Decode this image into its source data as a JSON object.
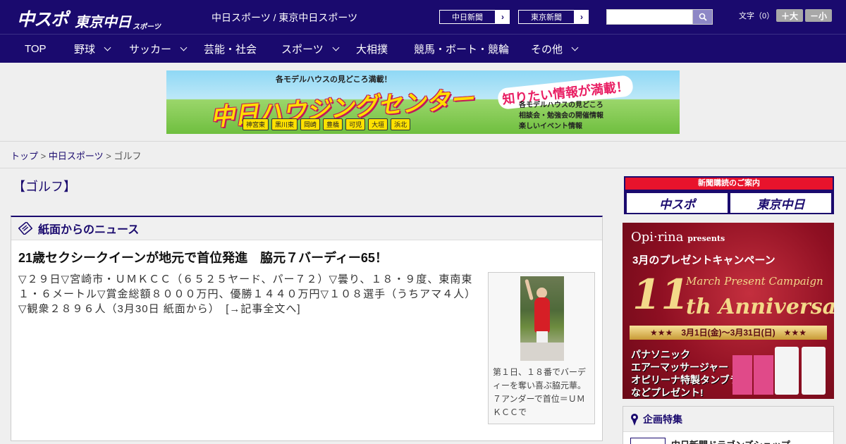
{
  "header": {
    "logo_main": "中スポ",
    "logo_sub": "東京中日",
    "logo_sub_small": "スポーツ",
    "site_title": "中日スポーツ / 東京中日スポーツ",
    "btn_chunichi": "中日新聞",
    "btn_tokyo": "東京新聞",
    "search_placeholder": "",
    "font_label": "文字（0）",
    "font_larger": "＋大",
    "font_smaller": "－小"
  },
  "nav": [
    {
      "label": "TOP",
      "dropdown": false
    },
    {
      "label": "野球",
      "dropdown": true
    },
    {
      "label": "サッカー",
      "dropdown": true
    },
    {
      "label": "芸能・社会",
      "dropdown": false
    },
    {
      "label": "スポーツ",
      "dropdown": true
    },
    {
      "label": "大相撲",
      "dropdown": false
    },
    {
      "label": "競馬・ボート・競輪",
      "dropdown": false
    },
    {
      "label": "その他",
      "dropdown": true
    }
  ],
  "ad": {
    "tagline": "各モデルハウスの見どころ満載！",
    "title": "中日ハウジングセンター",
    "side": "知りたい情報が満載！",
    "bullets": [
      "各モデルハウスの見どころ",
      "相談会・勉強会の開催情報",
      "楽しいイベント情報"
    ],
    "cities": [
      "神宮東",
      "黒川東",
      "岡崎",
      "豊橋",
      "可児",
      "大垣",
      "浜北"
    ]
  },
  "breadcrumb": {
    "top": "トップ",
    "section": "中日スポーツ",
    "current": "ゴルフ",
    "sep": ">"
  },
  "page_title": "【ゴルフ】",
  "news": {
    "section_title": "紙面からのニュース",
    "headline": "21歳セクシークイーンが地元で首位発進　脇元７バーディー65！",
    "body": "▽２９日▽宮崎市・ＵＭＫＣＣ（６５２５ヤード、パー７２）▽曇り、１８・９度、東南東１・６メートル▽賞金総額８０００万円、優勝１４４０万円▽１０８選手（うちアマ４人）▽観衆２８９６人（3月30日 紙面から）　[→記事全文へ]",
    "caption": "第１日、１８番でバーディーを奪い喜ぶ脇元華。７アンダーで首位＝ＵＭＫＣＣで"
  },
  "sidebar": {
    "subscribe_title": "新聞購読のご案内",
    "subscribe_btn1": "中スポ",
    "subscribe_btn2": "東京中日",
    "promo": {
      "brand": "Opi·rina",
      "presents": "presents",
      "campaign": "3月のプレゼントキャンペーン",
      "number": "11",
      "subtitle": "March Present Campaign",
      "anniversary": "th Anniversary",
      "dates": "★★★　3月1日(金)〜3月31日(日)　★★★",
      "gift_line1": "パナソニック",
      "gift_line2": "エアーマッサージャー",
      "gift_line3": "オピリーナ特製タンブラー",
      "gift_line4": "などプレゼント!"
    },
    "feature_title": "企画特集",
    "feature_item": "中日新聞ドラゴンズショップ"
  },
  "colors": {
    "brand_navy": "#1a0a6e",
    "accent_red": "#e8132c"
  }
}
